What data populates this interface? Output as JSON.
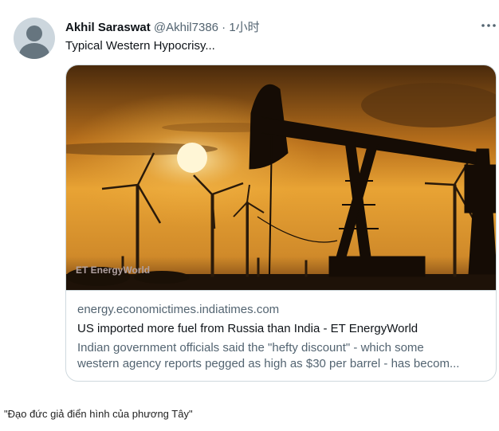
{
  "tweet": {
    "author_name": "Akhil Saraswat",
    "author_handle": "@Akhil7386",
    "separator": " · ",
    "time": "1小时",
    "more_icon": "more-horizontal-icon",
    "text": "Typical Western Hypocrisy..."
  },
  "card": {
    "image_description_icon": "oil-pumpjack-wind-turbines-sunset",
    "watermark": "ET EnergyWorld",
    "domain": "energy.economictimes.indiatimes.com",
    "title": "US imported more fuel from Russia than India - ET EnergyWorld",
    "description_line1": "Indian government officials said the \"hefty discount\" - which some",
    "description_line2": "western agency reports pegged as high as $30 per barrel - has becom..."
  },
  "caption": "\"Đạo đức giả điển hình của phương Tây\"",
  "colors": {
    "text_primary": "#0f1419",
    "text_secondary": "#536471",
    "border": "#cfd9de",
    "sky_top": "#3a2410",
    "sky_glow": "#e8a334"
  }
}
